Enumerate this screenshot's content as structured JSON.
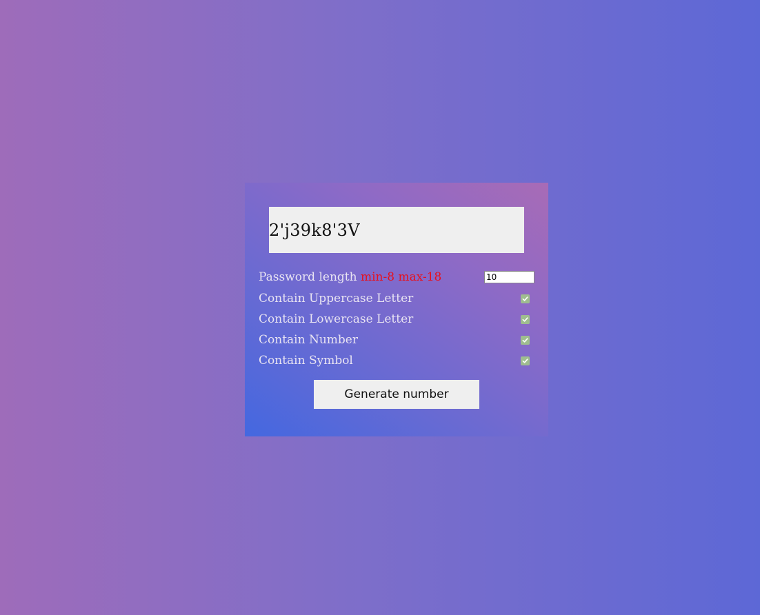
{
  "generator": {
    "password": "2'j39k8'3V",
    "length_label": "Password length ",
    "length_hint": "min-8 max-18",
    "length_value": "10",
    "options": [
      {
        "label": "Contain Uppercase Letter",
        "checked": true
      },
      {
        "label": "Contain Lowercase Letter",
        "checked": true
      },
      {
        "label": "Contain Number",
        "checked": true
      },
      {
        "label": "Contain Symbol",
        "checked": true
      }
    ],
    "button_label": "Generate number"
  },
  "colors": {
    "hint": "#e8101c",
    "checkbox": "#9fbd8f",
    "display_bg": "#efefef"
  }
}
